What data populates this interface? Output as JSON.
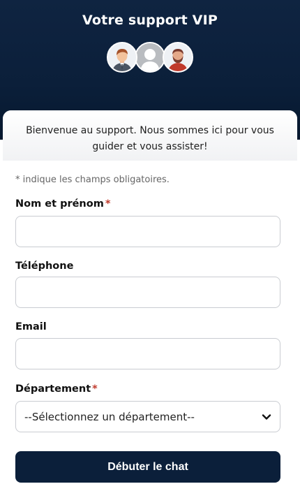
{
  "header": {
    "title": "Votre support VIP"
  },
  "welcome": {
    "text": "Bienvenue au support. Nous sommes ici pour vous guider et vous assister!"
  },
  "form": {
    "required_note": "* indique les champs obligatoires.",
    "required_marker": "*",
    "name_label": "Nom et prénom",
    "name_value": "",
    "phone_label": "Téléphone",
    "phone_value": "",
    "email_label": "Email",
    "email_value": "",
    "department_label": "Département",
    "department_selected": "--Sélectionnez un département--",
    "submit_label": "Débuter le chat"
  },
  "colors": {
    "header_bg": "#0b1f3a",
    "button_bg": "#0b1f3a",
    "required_star": "#c0392b"
  }
}
